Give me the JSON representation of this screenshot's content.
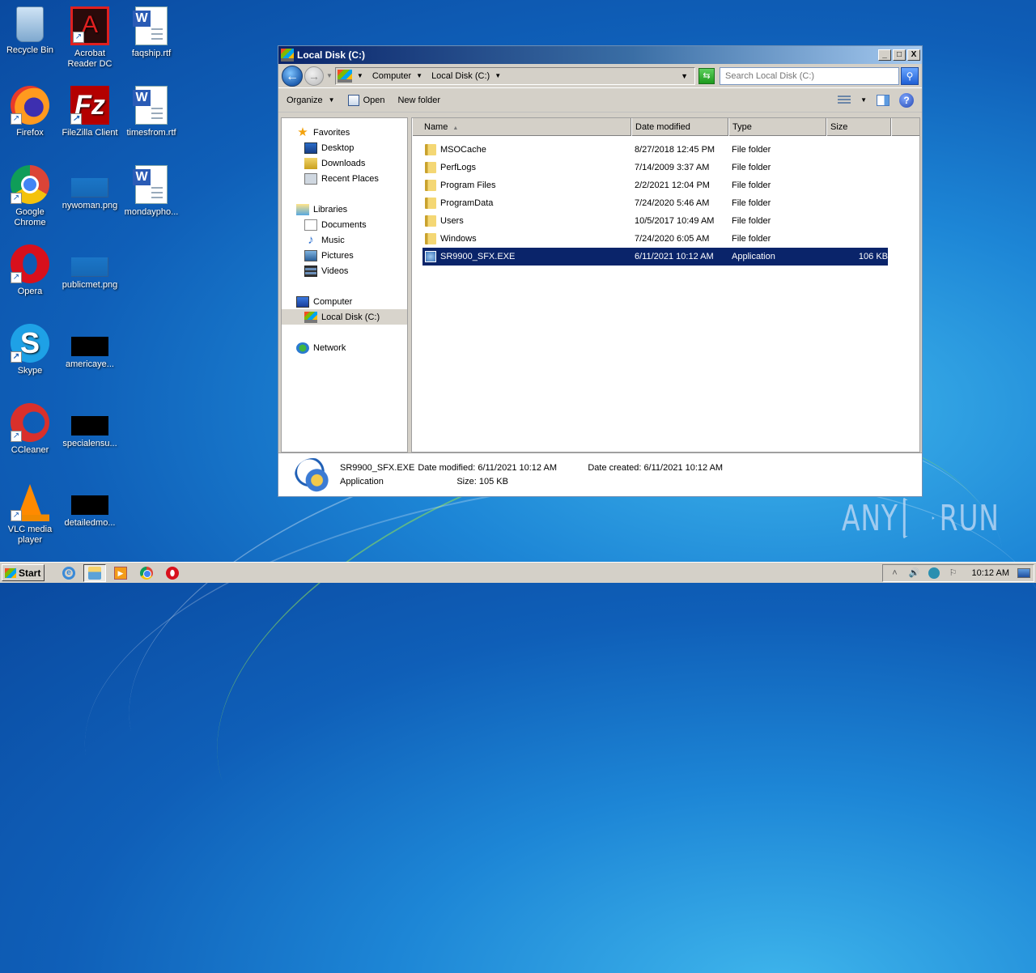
{
  "desktop": {
    "icons": [
      {
        "label": "Recycle Bin",
        "icon": "recycle-bin-icon"
      },
      {
        "label": "Acrobat Reader DC",
        "icon": "acrobat-icon"
      },
      {
        "label": "faqship.rtf",
        "icon": "word-doc-icon"
      },
      {
        "label": "Firefox",
        "icon": "firefox-icon"
      },
      {
        "label": "FileZilla Client",
        "icon": "filezilla-icon"
      },
      {
        "label": "timesfrom.rtf",
        "icon": "word-doc-icon"
      },
      {
        "label": "Google Chrome",
        "icon": "chrome-icon"
      },
      {
        "label": "nywoman.png",
        "icon": "image-thumbnail-icon"
      },
      {
        "label": "mondaypho...",
        "icon": "word-doc-icon"
      },
      {
        "label": "Opera",
        "icon": "opera-icon"
      },
      {
        "label": "publicmet.png",
        "icon": "image-thumbnail-icon"
      },
      {
        "label": "Skype",
        "icon": "skype-icon"
      },
      {
        "label": "americaye...",
        "icon": "image-thumbnail-icon"
      },
      {
        "label": "CCleaner",
        "icon": "ccleaner-icon"
      },
      {
        "label": "specialensu...",
        "icon": "image-thumbnail-icon"
      },
      {
        "label": "VLC media player",
        "icon": "vlc-icon"
      },
      {
        "label": "detailedmo...",
        "icon": "image-thumbnail-icon"
      }
    ]
  },
  "window": {
    "title": "Local Disk (C:)",
    "controls": {
      "minimize": "_",
      "maximize": "□",
      "close": "X"
    },
    "address": {
      "breadcrumbs": [
        "Computer",
        "Local Disk (C:)"
      ],
      "search_placeholder": "Search Local Disk (C:)"
    },
    "toolbar": {
      "organize": "Organize",
      "open": "Open",
      "new_folder": "New folder"
    },
    "nav": {
      "favorites": {
        "label": "Favorites",
        "items": [
          "Desktop",
          "Downloads",
          "Recent Places"
        ]
      },
      "libraries": {
        "label": "Libraries",
        "items": [
          "Documents",
          "Music",
          "Pictures",
          "Videos"
        ]
      },
      "computer": {
        "label": "Computer",
        "items": [
          "Local Disk (C:)"
        ]
      },
      "network": {
        "label": "Network"
      }
    },
    "columns": {
      "name": "Name",
      "date": "Date modified",
      "type": "Type",
      "size": "Size"
    },
    "files": [
      {
        "name": "MSOCache",
        "date": "8/27/2018 12:45 PM",
        "type": "File folder",
        "size": ""
      },
      {
        "name": "PerfLogs",
        "date": "7/14/2009 3:37 AM",
        "type": "File folder",
        "size": ""
      },
      {
        "name": "Program Files",
        "date": "2/2/2021 12:04 PM",
        "type": "File folder",
        "size": ""
      },
      {
        "name": "ProgramData",
        "date": "7/24/2020 5:46 AM",
        "type": "File folder",
        "size": ""
      },
      {
        "name": "Users",
        "date": "10/5/2017 10:49 AM",
        "type": "File folder",
        "size": ""
      },
      {
        "name": "Windows",
        "date": "7/24/2020 6:05 AM",
        "type": "File folder",
        "size": ""
      },
      {
        "name": "SR9900_SFX.EXE",
        "date": "6/11/2021 10:12 AM",
        "type": "Application",
        "size": "106 KB",
        "selected": true
      }
    ],
    "details": {
      "name": "SR9900_SFX.EXE",
      "modified": "Date modified: 6/11/2021 10:12 AM",
      "created": "Date created: 6/11/2021 10:12 AM",
      "type": "Application",
      "size": "Size: 105 KB"
    }
  },
  "taskbar": {
    "start": "Start",
    "apps": [
      "Internet Explorer",
      "Windows Explorer",
      "Windows Media Player",
      "Google Chrome",
      "Opera"
    ],
    "clock": "10:12 AM"
  },
  "watermark": {
    "left": "ANY",
    "right": "RUN"
  }
}
